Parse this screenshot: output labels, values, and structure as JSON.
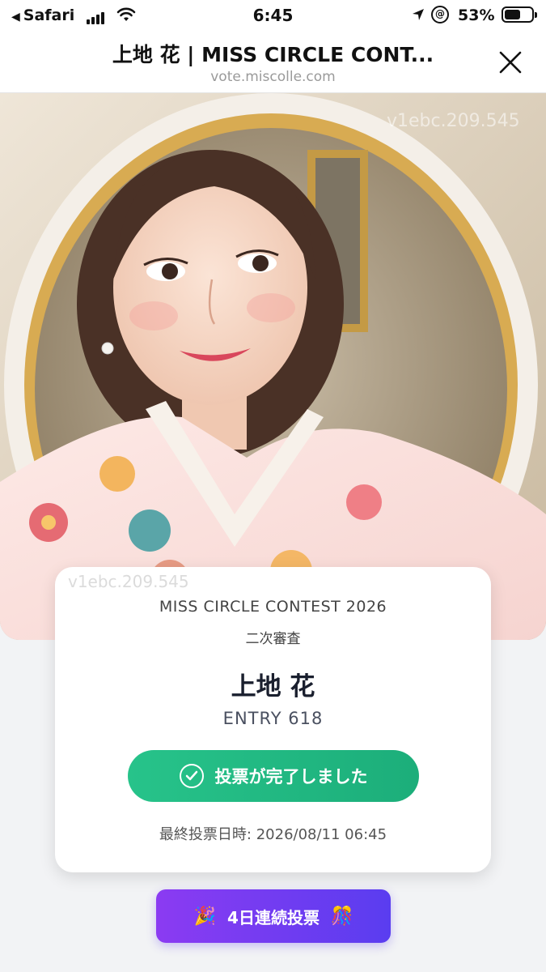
{
  "status_bar": {
    "back_label": "Safari",
    "time": "6:45",
    "battery": "53%"
  },
  "nav": {
    "title": "上地 花 | MISS CIRCLE CONT...",
    "url": "vote.miscolle.com"
  },
  "hero": {
    "watermark_top": "v1ebc.209.545",
    "watermark_card": "v1ebc.209.545"
  },
  "card": {
    "contest": "MISS CIRCLE CONTEST 2026",
    "stage": "二次審査",
    "name": "上地 花",
    "entry": "ENTRY 618",
    "vote_label": "投票が完了しました",
    "last_vote": "最終投票日時: 2026/08/11 06:45"
  },
  "streak": {
    "label": "4日連続投票",
    "emoji_left": "🎉",
    "emoji_right": "🎊"
  },
  "colors": {
    "vote_green": "#27c38a",
    "streak_purple": "#8b3bf2",
    "streak_indigo": "#5a3df0"
  }
}
